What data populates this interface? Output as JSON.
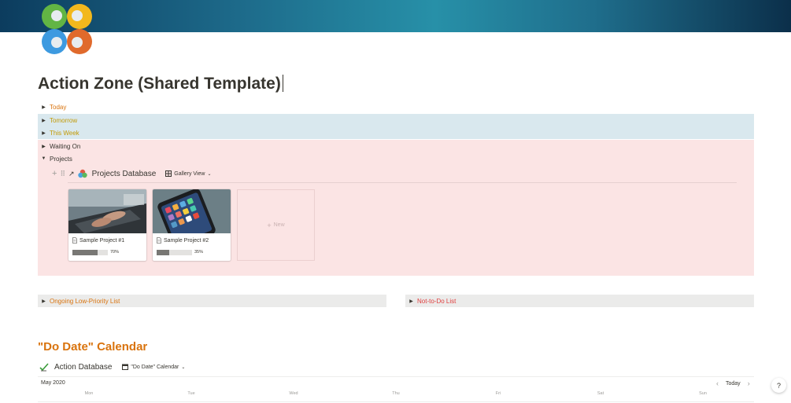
{
  "page": {
    "title": "Action Zone (Shared Template)"
  },
  "toggles": {
    "today": "Today",
    "tomorrow": "Tomorrow",
    "this_week": "This Week",
    "waiting_on": "Waiting On",
    "projects": "Projects",
    "low_priority": "Ongoing Low-Priority List",
    "not_to_do": "Not-to-Do List"
  },
  "projects_db": {
    "title": "Projects Database",
    "view": "Gallery View",
    "new_label": "New",
    "cards": [
      {
        "title": "Sample Project #1",
        "progress": 0.7,
        "progress_label": "70%",
        "cover": "laptop-typing-photo"
      },
      {
        "title": "Sample Project #2",
        "progress": 0.35,
        "progress_label": "35%",
        "cover": "smartphone-home-screen-photo"
      }
    ]
  },
  "calendar": {
    "heading": "\"Do Date\" Calendar",
    "db_title": "Action Database",
    "view": "\"Do Date\" Calendar",
    "month": "May 2020",
    "today_label": "Today",
    "weekdays": [
      "Mon",
      "Tue",
      "Wed",
      "Thu",
      "Fri",
      "Sat",
      "Sun"
    ]
  },
  "help": {
    "label": "?"
  },
  "colors": {
    "banner": "#1d6a8a",
    "orange": "#d9730d",
    "yellow": "#c29a05",
    "red": "#e03e3e",
    "blue_bg": "#d9e8ee",
    "red_bg": "#fbe4e4",
    "gray_bg": "#ebebea"
  },
  "icons": {
    "logo": "four-color-circles-logo",
    "projects_db": "colored-shapes-icon",
    "action_db": "check-pen-icon",
    "view": "gallery-grid-icon",
    "page": "page-icon"
  }
}
